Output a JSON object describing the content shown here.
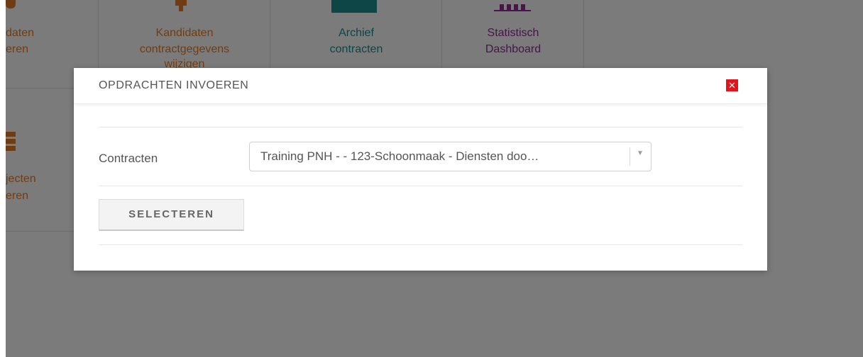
{
  "tiles": [
    {
      "line1": "daten",
      "line2": "eren",
      "color": "#e07b26"
    },
    {
      "line1": "Kandidaten",
      "line2": "contractgegevens",
      "line3": "wijzigen",
      "color": "#e07b26"
    },
    {
      "line1": "Archief",
      "line2": "contracten",
      "color": "#1d8a8c"
    },
    {
      "line1": "Statistisch",
      "line2": "Dashboard",
      "color": "#8a2d8f"
    },
    {
      "line1": "jecten",
      "line2": "eren",
      "color": "#e07b26"
    }
  ],
  "modal": {
    "title": "OPDRACHTEN INVOEREN",
    "close_icon": "close-icon",
    "close_color": "#e0161b",
    "field_label": "Contracten",
    "select_value": "Training PNH - - 123-Schoonmaak - Diensten doo…",
    "submit_label": "SELECTEREN"
  }
}
